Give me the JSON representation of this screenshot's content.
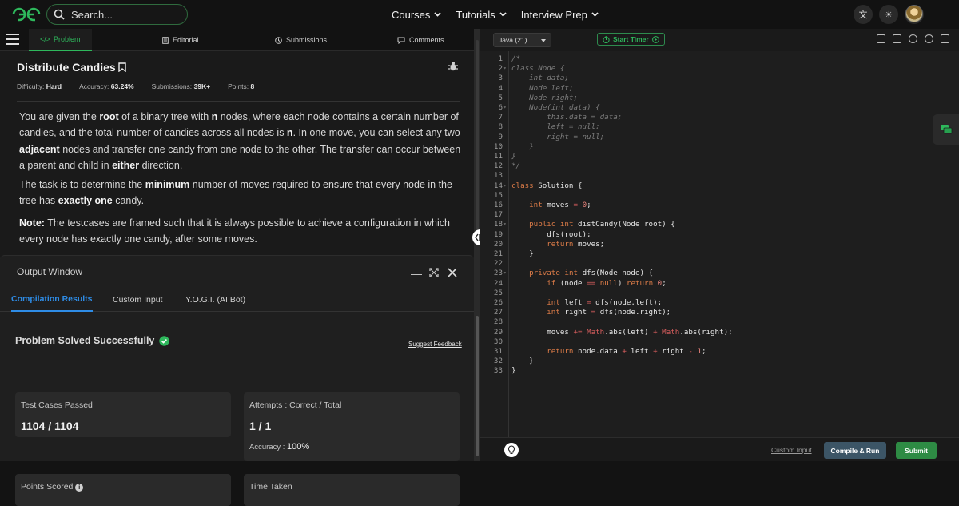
{
  "header": {
    "search_placeholder": "Search...",
    "nav": [
      {
        "label": "Courses"
      },
      {
        "label": "Tutorials"
      },
      {
        "label": "Interview Prep"
      }
    ],
    "brand_color": "#2eb85c"
  },
  "tabs": {
    "problem": "Problem",
    "editorial": "Editorial",
    "submissions": "Submissions",
    "comments": "Comments"
  },
  "problem": {
    "title": "Distribute Candies",
    "difficulty_label": "Difficulty:",
    "difficulty": "Hard",
    "accuracy_label": "Accuracy:",
    "accuracy": "63.24%",
    "submissions_label": "Submissions:",
    "submissions": "39K+",
    "points_label": "Points:",
    "points": "8",
    "p1": {
      "a": "You are given the ",
      "b": "root",
      "c": " of a binary tree with ",
      "d": "n",
      "e": " nodes, where each node contains a certain number of candies, and the total number of candies across all nodes is ",
      "f": "n",
      "g": ". In one move, you can select any two ",
      "h": "adjacent",
      "i": " nodes and transfer one candy from one node to the other. The transfer can occur between a parent and child in ",
      "j": "either",
      "k": " direction."
    },
    "p2": {
      "a": "The task is to determine the ",
      "b": "minimum",
      "c": " number of moves required to ensure that every node in the tree has ",
      "d": "exactly one",
      "e": " candy."
    },
    "p3": {
      "a": "Note:",
      "b": " The testcases are framed such that it is always possible to achieve a configuration in which every node has exactly one candy, after some moves."
    }
  },
  "output": {
    "title": "Output Window",
    "tabs": [
      "Compilation Results",
      "Custom Input",
      "Y.O.G.I. (AI Bot)"
    ],
    "status": "Problem Solved Successfully",
    "suggest": "Suggest Feedback",
    "cards": {
      "tests_label": "Test Cases Passed",
      "tests_value": "1104 / 1104",
      "attempts_label": "Attempts : Correct / Total",
      "attempts_value": "1 / 1",
      "accuracy_label": "Accuracy :",
      "accuracy_value": "100%",
      "points_label": "Points Scored",
      "time_label": "Time Taken"
    }
  },
  "editor": {
    "language": "Java (21)",
    "timer": "Start Timer",
    "custom_input": "Custom Input",
    "compile_run": "Compile & Run",
    "submit": "Submit",
    "lines": [
      "/*",
      "class Node {",
      "    int data;",
      "    Node left;",
      "    Node right;",
      "    Node(int data) {",
      "        this.data = data;",
      "        left = null;",
      "        right = null;",
      "    }",
      "}",
      "*/",
      "",
      "class Solution {",
      "",
      "    int moves = 0;",
      "",
      "    public int distCandy(Node root) {",
      "        dfs(root);",
      "        return moves;",
      "    }",
      "",
      "    private int dfs(Node node) {",
      "        if (node == null) return 0;",
      "",
      "        int left = dfs(node.left);",
      "        int right = dfs(node.right);",
      "",
      "        moves += Math.abs(left) + Math.abs(right);",
      "",
      "        return node.data + left + right - 1;",
      "    }",
      "}"
    ]
  }
}
